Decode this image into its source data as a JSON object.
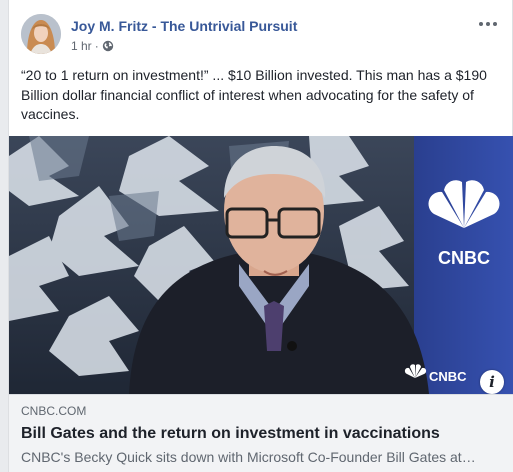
{
  "post": {
    "author": "Joy M. Fritz - The Untrivial Pursuit",
    "timestamp": "1 hr",
    "separator": "·",
    "audience_icon": "globe-icon",
    "more_icon": "more-options-icon",
    "text": "“20 to 1 return on investment!” ... $10 Billion invested. This man has a $190 Billion dollar financial conflict of interest when advocating for the safety of vaccines."
  },
  "media": {
    "watermark_label": "CNBC",
    "side_banner_label": "CNBC",
    "info_icon": "info-icon",
    "info_label": "i"
  },
  "link_preview": {
    "domain": "CNBC.COM",
    "title": "Bill Gates and the return on investment in vaccinations",
    "description": "CNBC's Becky Quick sits down with Microsoft Co-Founder Bill Gates at…"
  },
  "colors": {
    "author": "#385898",
    "secondary_text": "#606770",
    "link_box_bg": "#f2f3f5",
    "cnbc_blue": "#2f4ea3"
  }
}
